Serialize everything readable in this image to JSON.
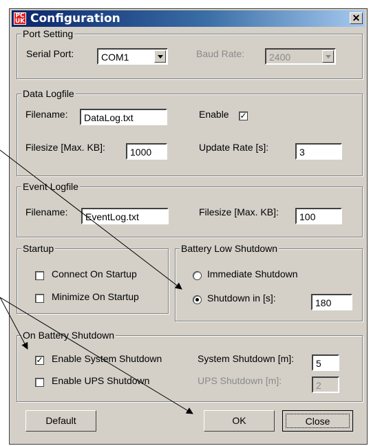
{
  "window": {
    "title": "Configuration",
    "close_glyph": "✕"
  },
  "port_setting": {
    "legend": "Port Setting",
    "serial_port_label": "Serial Port:",
    "serial_port_value": "COM1",
    "baud_rate_label": "Baud Rate:",
    "baud_rate_value": "2400"
  },
  "data_logfile": {
    "legend": "Data Logfile",
    "filename_label": "Filename:",
    "filename_value": "DataLog.txt",
    "enable_label": "Enable",
    "enable_checked": true,
    "filesize_label": "Filesize [Max. KB]:",
    "filesize_value": "1000",
    "update_rate_label": "Update Rate [s]:",
    "update_rate_value": "3"
  },
  "event_logfile": {
    "legend": "Event Logfile",
    "filename_label": "Filename:",
    "filename_value": "EventLog.txt",
    "filesize_label": "Filesize [Max. KB]:",
    "filesize_value": "100"
  },
  "startup": {
    "legend": "Startup",
    "connect_label": "Connect On Startup",
    "connect_checked": false,
    "minimize_label": "Minimize On Startup",
    "minimize_checked": false
  },
  "battery_low": {
    "legend": "Battery Low Shutdown",
    "immediate_label": "Immediate Shutdown",
    "immediate_selected": false,
    "shutdown_in_label": "Shutdown in [s]:",
    "shutdown_in_selected": true,
    "shutdown_in_value": "180"
  },
  "on_battery": {
    "legend": "On Battery Shutdown",
    "system_label": "Enable System Shutdown",
    "system_checked": true,
    "ups_label": "Enable UPS Shutdown",
    "ups_checked": false,
    "system_shutdown_label": "System Shutdown [m]:",
    "system_shutdown_value": "5",
    "ups_shutdown_label": "UPS Shutdown [m]:",
    "ups_shutdown_value": "2"
  },
  "buttons": {
    "default": "Default",
    "ok": "OK",
    "close": "Close"
  },
  "colors": {
    "dialog_bg": "#d4d0c8",
    "title_start": "#0a246a",
    "title_end": "#a6caf0",
    "disabled_text": "#8a8a8a",
    "annotation": "#000000"
  }
}
